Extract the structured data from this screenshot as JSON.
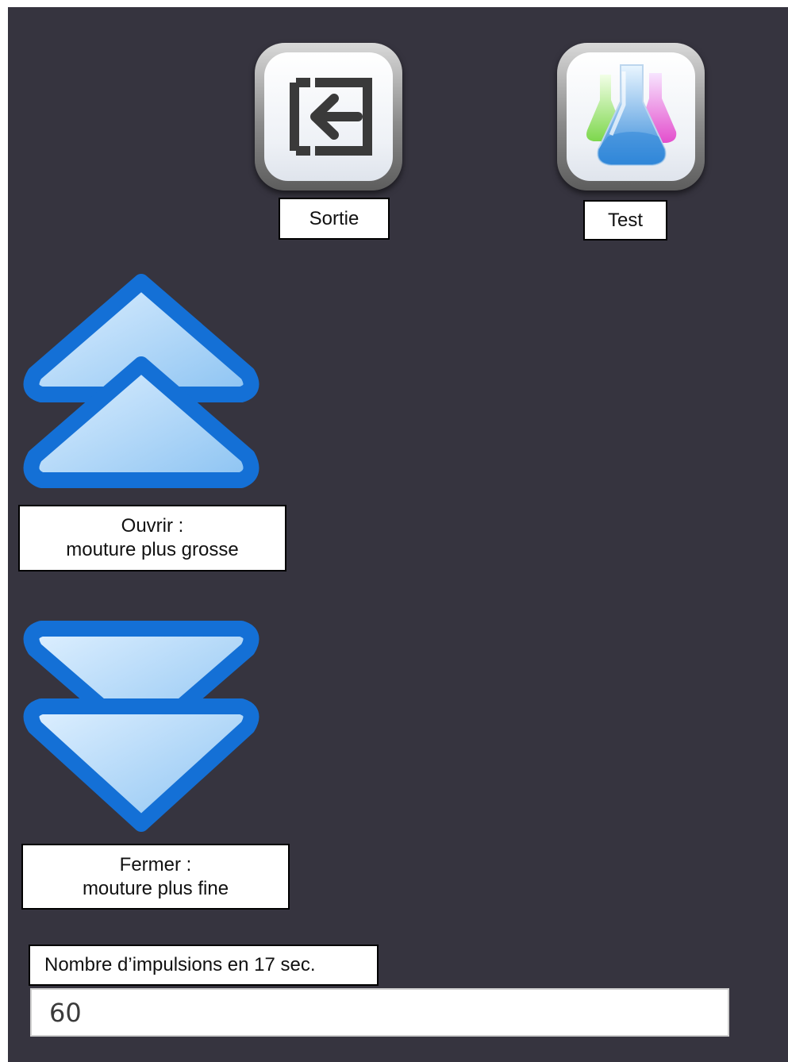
{
  "buttons": {
    "exit": {
      "icon": "exit-icon",
      "label": "Sortie"
    },
    "test": {
      "icon": "lab-flasks-icon",
      "label": "Test"
    },
    "open": {
      "icon": "double-chevron-up-icon",
      "label": "Ouvrir :\nmouture plus grosse"
    },
    "close": {
      "icon": "double-chevron-down-icon",
      "label": "Fermer :\nmouture plus fine"
    }
  },
  "pulses": {
    "label": "Nombre d’impulsions en 17 sec.",
    "value": "60"
  },
  "colors": {
    "background": "#36343f",
    "arrow_outline": "#1470d6",
    "arrow_fill": "#a9d4f7"
  }
}
